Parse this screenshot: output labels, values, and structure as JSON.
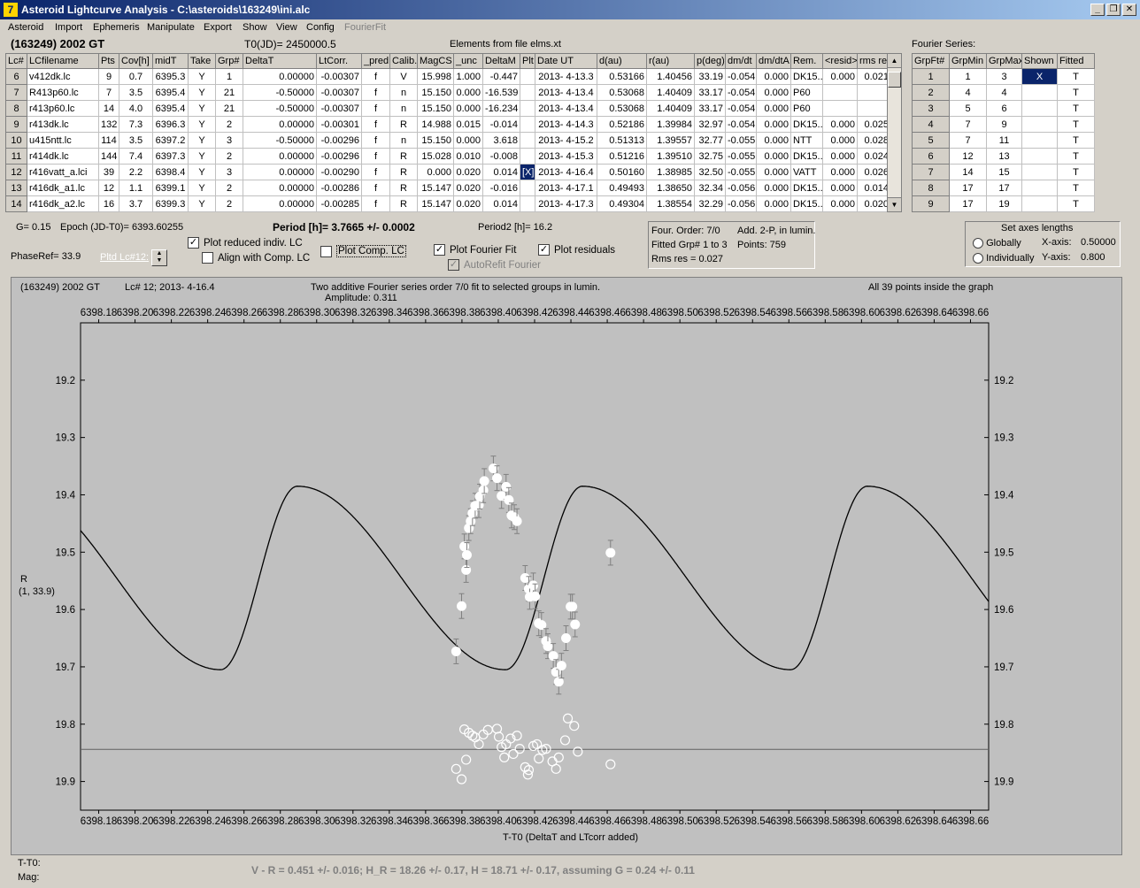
{
  "window": {
    "title": "Asteroid Lightcurve Analysis - C:\\asteroids\\163249\\ini.alc"
  },
  "menu": [
    "Asteroid",
    "Import",
    "Ephemeris",
    "Manipulate",
    "Export",
    "Show",
    "View",
    "Config",
    "FourierFit"
  ],
  "header": {
    "asteroid": "(163249) 2002 GT",
    "t0": "T0(JD)= 2450000.5",
    "elements": "Elements from file elms.xt",
    "fourier_title": "Fourier Series:"
  },
  "lc_table": {
    "columns": [
      "Lc#",
      "LCfilename",
      "Pts",
      "Cov[h]",
      "midT",
      "Take",
      "Grp#",
      "DeltaT",
      "LtCorr.",
      "_pred.",
      "Calib.",
      "MagCS",
      "_unc",
      "DeltaM",
      "Plt",
      "Date UT",
      "d(au)",
      "r(au)",
      "p(deg)",
      "dm/dt",
      "dm/dtA",
      "Rem.",
      "<resid>",
      "rms res"
    ],
    "rows": [
      [
        "6",
        "v412dk.lc",
        "9",
        "0.7",
        "6395.3",
        "Y",
        "1",
        "0.00000",
        "-0.00307",
        "f",
        "V",
        "15.998",
        "1.000",
        "-0.447",
        "",
        "2013- 4-13.3",
        "0.53166",
        "1.40456",
        "33.19",
        "-0.054",
        "0.000",
        "DK15..",
        "0.000",
        "0.021"
      ],
      [
        "7",
        "R413p60.lc",
        "7",
        "3.5",
        "6395.4",
        "Y",
        "21",
        "-0.50000",
        "-0.00307",
        "f",
        "n",
        "15.150",
        "0.000",
        "-16.539",
        "",
        "2013- 4-13.4",
        "0.53068",
        "1.40409",
        "33.17",
        "-0.054",
        "0.000",
        "P60",
        "",
        ""
      ],
      [
        "8",
        "r413p60.lc",
        "14",
        "4.0",
        "6395.4",
        "Y",
        "21",
        "-0.50000",
        "-0.00307",
        "f",
        "n",
        "15.150",
        "0.000",
        "-16.234",
        "",
        "2013- 4-13.4",
        "0.53068",
        "1.40409",
        "33.17",
        "-0.054",
        "0.000",
        "P60",
        "",
        ""
      ],
      [
        "9",
        "r413dk.lc",
        "132",
        "7.3",
        "6396.3",
        "Y",
        "2",
        "0.00000",
        "-0.00301",
        "f",
        "R",
        "14.988",
        "0.015",
        "-0.014",
        "",
        "2013- 4-14.3",
        "0.52186",
        "1.39984",
        "32.97",
        "-0.054",
        "0.000",
        "DK15..",
        "0.000",
        "0.025"
      ],
      [
        "10",
        "u415ntt.lc",
        "114",
        "3.5",
        "6397.2",
        "Y",
        "3",
        "-0.50000",
        "-0.00296",
        "f",
        "n",
        "15.150",
        "0.000",
        "3.618",
        "",
        "2013- 4-15.2",
        "0.51313",
        "1.39557",
        "32.77",
        "-0.055",
        "0.000",
        "NTT",
        "0.000",
        "0.028"
      ],
      [
        "11",
        "r414dk.lc",
        "144",
        "7.4",
        "6397.3",
        "Y",
        "2",
        "0.00000",
        "-0.00296",
        "f",
        "R",
        "15.028",
        "0.010",
        "-0.008",
        "",
        "2013- 4-15.3",
        "0.51216",
        "1.39510",
        "32.75",
        "-0.055",
        "0.000",
        "DK15..",
        "0.000",
        "0.024"
      ],
      [
        "12",
        "r416vatt_a.lci",
        "39",
        "2.2",
        "6398.4",
        "Y",
        "3",
        "0.00000",
        "-0.00290",
        "f",
        "R",
        "0.000",
        "0.020",
        "0.014",
        "[X]",
        "2013- 4-16.4",
        "0.50160",
        "1.38985",
        "32.50",
        "-0.055",
        "0.000",
        "VATT",
        "0.000",
        "0.026"
      ],
      [
        "13",
        "r416dk_a1.lc",
        "12",
        "1.1",
        "6399.1",
        "Y",
        "2",
        "0.00000",
        "-0.00286",
        "f",
        "R",
        "15.147",
        "0.020",
        "-0.016",
        "",
        "2013- 4-17.1",
        "0.49493",
        "1.38650",
        "32.34",
        "-0.056",
        "0.000",
        "DK15..",
        "0.000",
        "0.014"
      ],
      [
        "14",
        "r416dk_a2.lc",
        "16",
        "3.7",
        "6399.3",
        "Y",
        "2",
        "0.00000",
        "-0.00285",
        "f",
        "R",
        "15.147",
        "0.020",
        "0.014",
        "",
        "2013- 4-17.3",
        "0.49304",
        "1.38554",
        "32.29",
        "-0.056",
        "0.000",
        "DK15..",
        "0.000",
        "0.020"
      ]
    ]
  },
  "fourier_table": {
    "columns": [
      "GrpFt#",
      "GrpMin",
      "GrpMax",
      "Shown",
      "Fitted"
    ],
    "rows": [
      [
        "1",
        "1",
        "3",
        "X",
        "T"
      ],
      [
        "2",
        "4",
        "4",
        "",
        "T"
      ],
      [
        "3",
        "5",
        "6",
        "",
        "T"
      ],
      [
        "4",
        "7",
        "9",
        "",
        "T"
      ],
      [
        "5",
        "7",
        "11",
        "",
        "T"
      ],
      [
        "6",
        "12",
        "13",
        "",
        "T"
      ],
      [
        "7",
        "14",
        "15",
        "",
        "T"
      ],
      [
        "8",
        "17",
        "17",
        "",
        "T"
      ],
      [
        "9",
        "17",
        "19",
        "",
        "T"
      ]
    ]
  },
  "controls": {
    "g": "G= 0.15",
    "epoch": "Epoch (JD-T0)= 6393.60255",
    "period": "Period [h]= 3.7665 +/- 0.0002",
    "period2": "Period2 [h]= 16.2",
    "phaseref": "PhaseRef= 33.9",
    "pltd_lc": "Pltd Lc#12:",
    "plot_reduced": "Plot reduced indiv. LC",
    "align_comp": "Align with Comp. LC",
    "plot_comp": "Plot Comp. LC",
    "plot_fourier": "Plot Fourier Fit",
    "autorefit": "AutoRefit Fourier",
    "plot_residuals": "Plot residuals",
    "four_order": "Four. Order:  7/0",
    "add": "Add. 2-P, in lumin.",
    "fitted_grp": "Fitted Grp# 1 to 3",
    "points": "Points: 759",
    "rms": "Rms res     = 0.027",
    "axes_title": "Set axes lengths",
    "globally": "Globally",
    "individually": "Individually",
    "xaxis_label": "X-axis:",
    "xaxis_val": "0.50000",
    "yaxis_label": "Y-axis:",
    "yaxis_val": "0.800"
  },
  "plot": {
    "left_title": "(163249) 2002 GT",
    "lc_info": "Lc# 12; 2013- 4-16.4",
    "center_title": "Two additive Fourier series order 7/0 fit to selected groups in lumin.",
    "amplitude": "Amplitude: 0.311",
    "right_title": "All 39 points inside the graph",
    "ylabel": "R",
    "ylabel2": "(1, 33.9)",
    "xlabel": "T-T0 (DeltaT and LTcorr added)",
    "t_t0": "T-T0:",
    "mag": "Mag:",
    "footer": "V - R = 0.451 +/- 0.016; H_R = 18.26 +/- 0.17, H = 18.71 +/- 0.17, assuming G = 0.24 +/- 0.11"
  },
  "chart_data": {
    "type": "scatter",
    "xlim": [
      6398.17,
      6398.67
    ],
    "ylim": [
      19.1,
      19.95
    ],
    "y_inverted": true,
    "xticks": [
      "6398.18",
      "6398.20",
      "6398.22",
      "6398.24",
      "6398.26",
      "6398.28",
      "6398.30",
      "6398.32",
      "6398.34",
      "6398.36",
      "6398.38",
      "6398.40",
      "6398.42",
      "6398.44",
      "6398.46",
      "6398.48",
      "6398.50",
      "6398.52",
      "6398.54",
      "6398.56",
      "6398.58",
      "6398.60",
      "6398.62",
      "6398.64",
      "6398.66"
    ],
    "yticks": [
      "19.2",
      "19.3",
      "19.4",
      "19.5",
      "19.6",
      "19.7",
      "19.8",
      "19.9"
    ],
    "fit_period_days": 0.1569,
    "fit_peak_x": 6398.404,
    "fit_min": 19.385,
    "fit_max": 19.705,
    "residual_level": 19.844,
    "points": [
      [
        6398.3768,
        19.673
      ],
      [
        6398.3798,
        19.594
      ],
      [
        6398.3813,
        19.49
      ],
      [
        6398.3823,
        19.531
      ],
      [
        6398.3827,
        19.505
      ],
      [
        6398.3838,
        19.458
      ],
      [
        6398.3848,
        19.446
      ],
      [
        6398.3858,
        19.432
      ],
      [
        6398.3873,
        19.419
      ],
      [
        6398.3893,
        19.418
      ],
      [
        6398.3898,
        19.403
      ],
      [
        6398.3918,
        19.392
      ],
      [
        6398.3923,
        19.376
      ],
      [
        6398.3973,
        19.354
      ],
      [
        6398.3993,
        19.371
      ],
      [
        6398.4018,
        19.402
      ],
      [
        6398.4043,
        19.386
      ],
      [
        6398.4058,
        19.409
      ],
      [
        6398.4073,
        19.436
      ],
      [
        6398.4088,
        19.439
      ],
      [
        6398.4103,
        19.446
      ],
      [
        6398.4148,
        19.545
      ],
      [
        6398.4168,
        19.564
      ],
      [
        6398.4173,
        19.578
      ],
      [
        6398.4193,
        19.558
      ],
      [
        6398.4203,
        19.577
      ],
      [
        6398.4223,
        19.624
      ],
      [
        6398.4238,
        19.627
      ],
      [
        6398.4263,
        19.655
      ],
      [
        6398.4273,
        19.664
      ],
      [
        6398.4303,
        19.681
      ],
      [
        6398.4318,
        19.709
      ],
      [
        6398.4333,
        19.726
      ],
      [
        6398.4348,
        19.698
      ],
      [
        6398.4373,
        19.65
      ],
      [
        6398.4398,
        19.595
      ],
      [
        6398.4408,
        19.595
      ],
      [
        6398.4423,
        19.626
      ],
      [
        6398.4618,
        19.501
      ]
    ],
    "residuals": [
      [
        6398.3768,
        19.878
      ],
      [
        6398.3798,
        19.896
      ],
      [
        6398.3813,
        19.809
      ],
      [
        6398.3823,
        19.862
      ],
      [
        6398.3838,
        19.815
      ],
      [
        6398.3858,
        19.82
      ],
      [
        6398.3873,
        19.823
      ],
      [
        6398.3893,
        19.835
      ],
      [
        6398.3918,
        19.818
      ],
      [
        6398.3943,
        19.81
      ],
      [
        6398.3993,
        19.808
      ],
      [
        6398.4003,
        19.822
      ],
      [
        6398.4018,
        19.84
      ],
      [
        6398.4033,
        19.858
      ],
      [
        6398.4043,
        19.835
      ],
      [
        6398.4068,
        19.825
      ],
      [
        6398.4083,
        19.852
      ],
      [
        6398.4103,
        19.82
      ],
      [
        6398.4118,
        19.843
      ],
      [
        6398.4148,
        19.875
      ],
      [
        6398.4163,
        19.888
      ],
      [
        6398.4168,
        19.88
      ],
      [
        6398.4193,
        19.838
      ],
      [
        6398.4213,
        19.835
      ],
      [
        6398.4223,
        19.86
      ],
      [
        6398.4243,
        19.845
      ],
      [
        6398.4263,
        19.843
      ],
      [
        6398.4298,
        19.865
      ],
      [
        6398.4318,
        19.878
      ],
      [
        6398.4333,
        19.858
      ],
      [
        6398.4368,
        19.828
      ],
      [
        6398.4383,
        19.79
      ],
      [
        6398.4418,
        19.803
      ],
      [
        6398.4438,
        19.848
      ],
      [
        6398.4618,
        19.87
      ]
    ]
  }
}
